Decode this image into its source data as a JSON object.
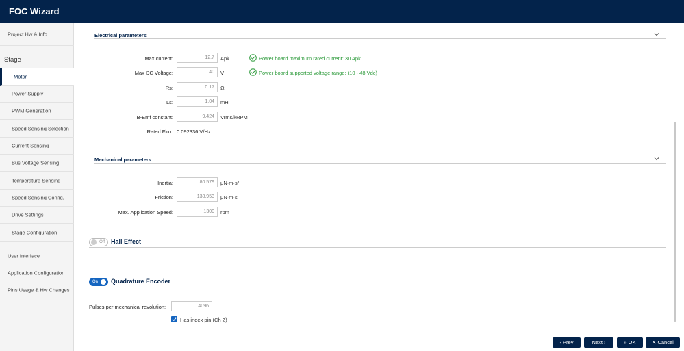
{
  "app": {
    "title": "FOC Wizard"
  },
  "sidebar": {
    "project": "Project Hw & Info",
    "stage_heading": "Stage",
    "stage_items": [
      "Motor",
      "Power Supply",
      "PWM Generation",
      "Speed Sensing Selection",
      "Current Sensing",
      "Bus Voltage Sensing",
      "Temperature Sensing",
      "Speed Sensing Config.",
      "Drive Settings",
      "Stage Configuration"
    ],
    "active": "Motor",
    "bottom_items": [
      "User Interface",
      "Application Configuration",
      "Pins Usage & Hw Changes"
    ]
  },
  "electrical": {
    "title": "Electrical parameters",
    "max_current": {
      "label": "Max current:",
      "value": "12.7",
      "unit": "Apk",
      "status": "Power board maximum rated current: 30 Apk"
    },
    "max_dc_voltage": {
      "label": "Max DC Voltage:",
      "value": "40",
      "unit": "V",
      "status": "Power board supported voltage range: (10 - 48 Vdc)"
    },
    "rs": {
      "label": "Rs:",
      "value": "0.17",
      "unit": "Ω"
    },
    "ls": {
      "label": "Ls:",
      "value": "1.04",
      "unit": "mH"
    },
    "bemf": {
      "label": "B-Emf constant:",
      "value": "9.424",
      "unit": "Vrms/kRPM"
    },
    "rated_flux": {
      "label": "Rated Flux:",
      "value": "0.092336 V/Hz"
    }
  },
  "mechanical": {
    "title": "Mechanical parameters",
    "inertia": {
      "label": "Inertia:",
      "value": "80.579",
      "unit": "μN·m·s²"
    },
    "friction": {
      "label": "Friction:",
      "value": "138.953",
      "unit": "μN·m·s"
    },
    "max_speed": {
      "label": "Max. Application Speed:",
      "value": "1300",
      "unit": "rpm"
    }
  },
  "hall": {
    "title": "Hall Effect",
    "toggle": "Off"
  },
  "encoder": {
    "title": "Quadrature Encoder",
    "toggle": "On",
    "pulses": {
      "label": "Pulses per mechanical revolution:",
      "value": "4096"
    },
    "index_pin": {
      "label": "Has index pin (Ch Z)",
      "checked": true
    }
  },
  "footer": {
    "prev": "Prev",
    "next": "Next",
    "ok": "OK",
    "cancel": "Cancel"
  },
  "colors": {
    "primary": "#03234b",
    "accent": "#1565c0",
    "success": "#2c9a3a"
  }
}
